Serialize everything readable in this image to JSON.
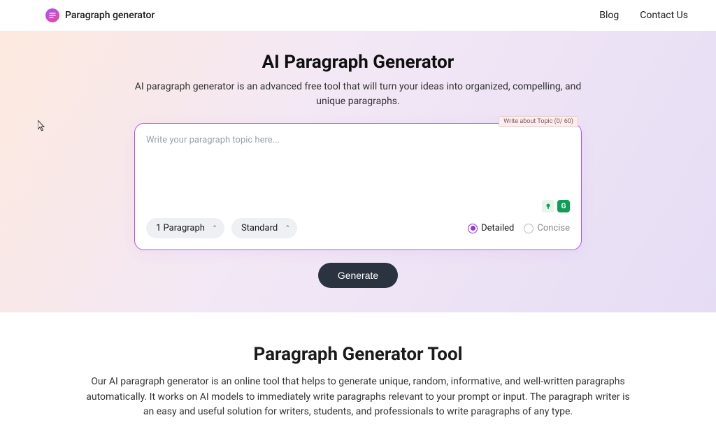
{
  "header": {
    "brand": "Paragraph generator",
    "nav": [
      "Blog",
      "Contact Us"
    ]
  },
  "hero": {
    "title": "AI Paragraph Generator",
    "subtitle": "AI paragraph generator is an advanced free tool that will turn your ideas into organized, compelling, and unique paragraphs.",
    "badge": "Write about Topic (0/ 60)",
    "placeholder": "Write your paragraph topic here...",
    "select_count": "1 Paragraph",
    "select_tone": "Standard",
    "radio_detailed": "Detailed",
    "radio_concise": "Concise",
    "generate": "Generate"
  },
  "section2": {
    "title": "Paragraph Generator Tool",
    "body": "Our AI paragraph generator is an online tool that helps to generate unique, random, informative, and well-written paragraphs automatically. It works on AI models to immediately write paragraphs relevant to your prompt or input. The paragraph writer is an easy and useful solution for writers, students, and professionals to write paragraphs of any type."
  }
}
